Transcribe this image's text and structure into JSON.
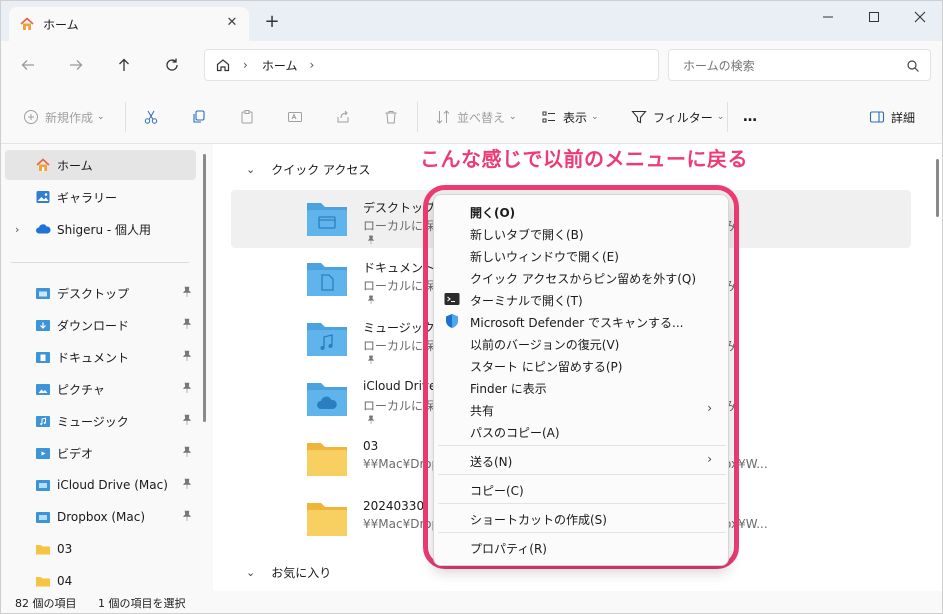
{
  "tab": {
    "title": "ホーム",
    "new_tab": "+"
  },
  "address": {
    "crumb": "ホーム",
    "sep1": "›",
    "sep2": "›"
  },
  "search": {
    "placeholder": "ホームの検索"
  },
  "toolbar": {
    "new_label": "新規作成",
    "sort_label": "並べ替え",
    "view_label": "表示",
    "filter_label": "フィルター",
    "more_label": "…",
    "details_label": "詳細"
  },
  "sidebar": {
    "home": "ホーム",
    "gallery": "ギャラリー",
    "onedrive": "Shigeru - 個人用",
    "items": [
      {
        "label": "デスクトップ",
        "icon": "desktop-folder-icon"
      },
      {
        "label": "ダウンロード",
        "icon": "download-folder-icon"
      },
      {
        "label": "ドキュメント",
        "icon": "documents-folder-icon"
      },
      {
        "label": "ピクチャ",
        "icon": "pictures-folder-icon"
      },
      {
        "label": "ミュージック",
        "icon": "music-folder-icon"
      },
      {
        "label": "ビデオ",
        "icon": "videos-folder-icon"
      },
      {
        "label": "iCloud Drive (Mac)",
        "icon": "icloud-folder-icon"
      },
      {
        "label": "Dropbox (Mac)",
        "icon": "dropbox-folder-icon"
      },
      {
        "label": "03",
        "icon": "folder-icon"
      },
      {
        "label": "04",
        "icon": "folder-icon"
      }
    ]
  },
  "main": {
    "quick_access": "クイック アクセス",
    "favorites": "お気に入り",
    "items": [
      {
        "name": "デスクトップ",
        "sub": "ローカルに保存",
        "right": "み"
      },
      {
        "name": "ドキュメント",
        "sub": "ローカルに保存",
        "right": "み"
      },
      {
        "name": "ミュージック",
        "sub": "ローカルに保存",
        "right": "み"
      },
      {
        "name": "iCloud Drive (",
        "sub": "ローカルに保存",
        "right": "み"
      },
      {
        "name": "03",
        "sub": "¥¥Mac¥Drop",
        "right": "ox¥W..."
      },
      {
        "name": "20240330",
        "sub": "¥¥Mac¥Drop",
        "right": "ox¥W..."
      }
    ]
  },
  "annotation": "こんな感じで以前のメニューに戻る",
  "context_menu": {
    "items": [
      {
        "label": "開く(O)",
        "bold": true
      },
      {
        "label": "新しいタブで開く(B)"
      },
      {
        "label": "新しいウィンドウで開く(E)"
      },
      {
        "label": "クイック アクセスからピン留めを外す(Q)"
      },
      {
        "label": "ターミナルで開く(T)",
        "icon": "terminal-icon"
      },
      {
        "label": "Microsoft Defender でスキャンする...",
        "icon": "defender-shield-icon"
      },
      {
        "label": "以前のバージョンの復元(V)"
      },
      {
        "label": "スタート にピン留めする(P)"
      },
      {
        "label": "Finder に表示"
      },
      {
        "label": "共有",
        "submenu": true
      },
      {
        "label": "パスのコピー(A)"
      },
      {
        "label": "送る(N)",
        "submenu": true
      },
      {
        "label": "コピー(C)"
      },
      {
        "label": "ショートカットの作成(S)"
      },
      {
        "label": "プロパティ(R)"
      }
    ],
    "arrow": "›"
  },
  "status": {
    "count": "82 個の項目",
    "selected": "1 個の項目を選択"
  },
  "colors": {
    "accent": "#ee3b74",
    "folder_blue": "#4aa3df",
    "folder_yellow": "#f6c443"
  }
}
